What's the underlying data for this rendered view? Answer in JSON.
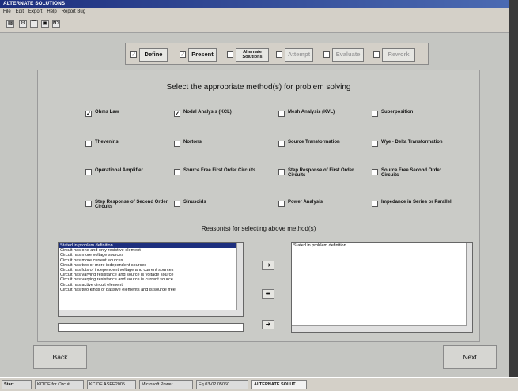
{
  "window": {
    "title": "ALTERNATE SOLUTIONS"
  },
  "menu": [
    "File",
    "Edit",
    "Export",
    "Help",
    "Report Bug"
  ],
  "toolbar_icons": [
    "save-icon",
    "tools-icon",
    "copy-icon",
    "window-icon",
    "help-icon"
  ],
  "help_glyph": "N?",
  "steps": [
    {
      "label": "Define",
      "checked": true,
      "enabled": true
    },
    {
      "label": "Present",
      "checked": true,
      "enabled": true
    },
    {
      "label": "Alternate Solutions",
      "checked": false,
      "enabled": true
    },
    {
      "label": "Attempt",
      "checked": false,
      "enabled": false
    },
    {
      "label": "Evaluate",
      "checked": false,
      "enabled": false
    },
    {
      "label": "Rework",
      "checked": false,
      "enabled": false
    }
  ],
  "heading": "Select the appropriate method(s) for problem solving",
  "methods": [
    {
      "label": "Ohms Law",
      "checked": true
    },
    {
      "label": "Nodal Analysis (KCL)",
      "checked": true
    },
    {
      "label": "Mesh Analysis (KVL)",
      "checked": false
    },
    {
      "label": "Superposition",
      "checked": false
    },
    {
      "label": "Thevenins",
      "checked": false
    },
    {
      "label": "Nortons",
      "checked": false
    },
    {
      "label": "Source Transformation",
      "checked": false
    },
    {
      "label": "Wye - Delta Transformation",
      "checked": false
    },
    {
      "label": "Operational Amplifier",
      "checked": false
    },
    {
      "label": "Source Free First Order Circuits",
      "checked": false
    },
    {
      "label": "Step Response of First Order Circuits",
      "checked": false
    },
    {
      "label": "Source Free Second Order Circuits",
      "checked": false
    },
    {
      "label": "Step Response of Second Order Circuits",
      "checked": false
    },
    {
      "label": "Sinusoids",
      "checked": false
    },
    {
      "label": "Power Analysis",
      "checked": false
    },
    {
      "label": "Impedance in Series or Parallel",
      "checked": false
    }
  ],
  "reasons_heading": "Reason(s) for selecting above method(s)",
  "reasons_available": [
    "Stated in problem definition",
    "Circuit has one and only resistive element",
    "Circuit has more voltage sources",
    "Circuit has more current sources",
    "Circuit has two or more independent sources",
    "Circuit has lots of independent voltage and current sources",
    "Circuit has varying resistance and source is voltage source",
    "Circuit has varying resistance and source is current source",
    "Circuit has active circuit element",
    "Circuit has two kinds of passive elements and is source free"
  ],
  "reasons_selected": [
    "Stated in problem definition"
  ],
  "custom_reason_value": "",
  "buttons": {
    "back": "Back",
    "next": "Next"
  },
  "taskbar": {
    "start": "Start",
    "tasks": [
      "KCIDE for Circuit...",
      "KCIDE ASEE2005",
      "Microsoft Power...",
      "Eq 03-02 05060...",
      "ALTERNATE SOLUT..."
    ]
  }
}
